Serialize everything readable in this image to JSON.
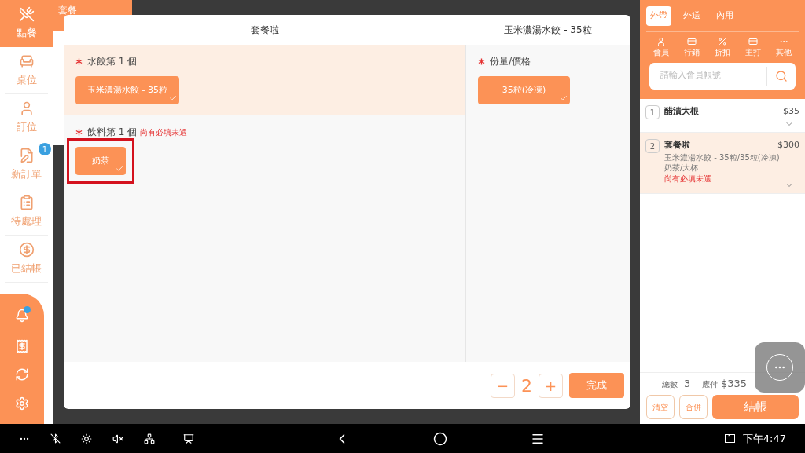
{
  "sidebar": {
    "items": [
      {
        "label": "點餐",
        "selected": true
      },
      {
        "label": "桌位",
        "selected": false
      },
      {
        "label": "訂位",
        "selected": false
      },
      {
        "label": "新訂單",
        "selected": false,
        "badge": "1"
      },
      {
        "label": "待處理",
        "selected": false
      },
      {
        "label": "已結帳",
        "selected": false
      }
    ],
    "bell_unread": true
  },
  "background_list": {
    "header": "套餐"
  },
  "modal": {
    "title": "套餐啦",
    "detail_title": "玉米濃湯水餃 - 35粒",
    "groups": [
      {
        "label": "水餃第 1 個",
        "required": true,
        "active": true,
        "options": [
          {
            "label": "玉米濃湯水餃 - 35粒",
            "selected": true
          }
        ]
      },
      {
        "label": "飲料第 1 個",
        "required": true,
        "warning": "尚有必填未選",
        "active": false,
        "highlighted": true,
        "options": [
          {
            "label": "奶茶",
            "selected": true
          }
        ]
      }
    ],
    "detail_groups": [
      {
        "label": "份量/價格",
        "required": true,
        "options": [
          {
            "label": "35粒(冷凍)",
            "selected": true
          }
        ]
      }
    ],
    "quantity": "2",
    "minus": "−",
    "plus": "+",
    "done": "完成"
  },
  "order_panel": {
    "tabs": [
      {
        "label": "外帶",
        "selected": true
      },
      {
        "label": "外送",
        "selected": false
      },
      {
        "label": "內用",
        "selected": false
      }
    ],
    "tools": [
      "會員",
      "行銷",
      "折扣",
      "主打",
      "其他"
    ],
    "search": {
      "placeholder": "請輸入會員帳號"
    },
    "items": [
      {
        "index": "1",
        "name": "醋漬大根",
        "price": "$35",
        "selected": false
      },
      {
        "index": "2",
        "name": "套餐啦",
        "price": "$300",
        "details": [
          "玉米濃湯水餃 - 35粒/35粒(冷凍)",
          "奶茶/大杯"
        ],
        "warning": "尚有必填未選",
        "selected": true
      }
    ],
    "total_label": "總數",
    "total": "3",
    "due_label": "應付",
    "due": "$335",
    "clear": "清空",
    "merge": "合併",
    "checkout": "結帳"
  },
  "system_bar": {
    "window_count": "1",
    "time": "下午4:47"
  }
}
